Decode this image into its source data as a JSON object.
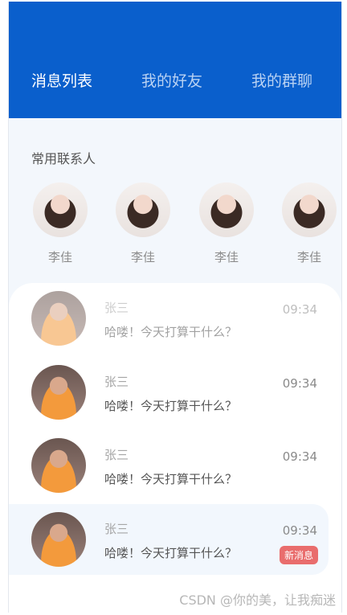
{
  "tabs": [
    {
      "label": "消息列表"
    },
    {
      "label": "我的好友"
    },
    {
      "label": "我的群聊"
    }
  ],
  "contacts_section": {
    "title": "常用联系人",
    "contacts": [
      {
        "name": "李佳"
      },
      {
        "name": "李佳"
      },
      {
        "name": "李佳"
      },
      {
        "name": "李佳"
      }
    ]
  },
  "chats": [
    {
      "name": "张三",
      "message": "哈喽！今天打算干什么？",
      "time": "09:34"
    },
    {
      "name": "张三",
      "message": "哈喽！今天打算干什么？",
      "time": "09:34"
    },
    {
      "name": "张三",
      "message": "哈喽！今天打算干什么？",
      "time": "09:34"
    },
    {
      "name": "张三",
      "message": "哈喽！今天打算干什么？",
      "time": "09:34",
      "badge": "新消息"
    }
  ],
  "watermark": "CSDN @你的美，让我痴迷",
  "colors": {
    "header": "#0a5fcc",
    "badge": "#e96d6d",
    "background": "#f3f7fc"
  }
}
